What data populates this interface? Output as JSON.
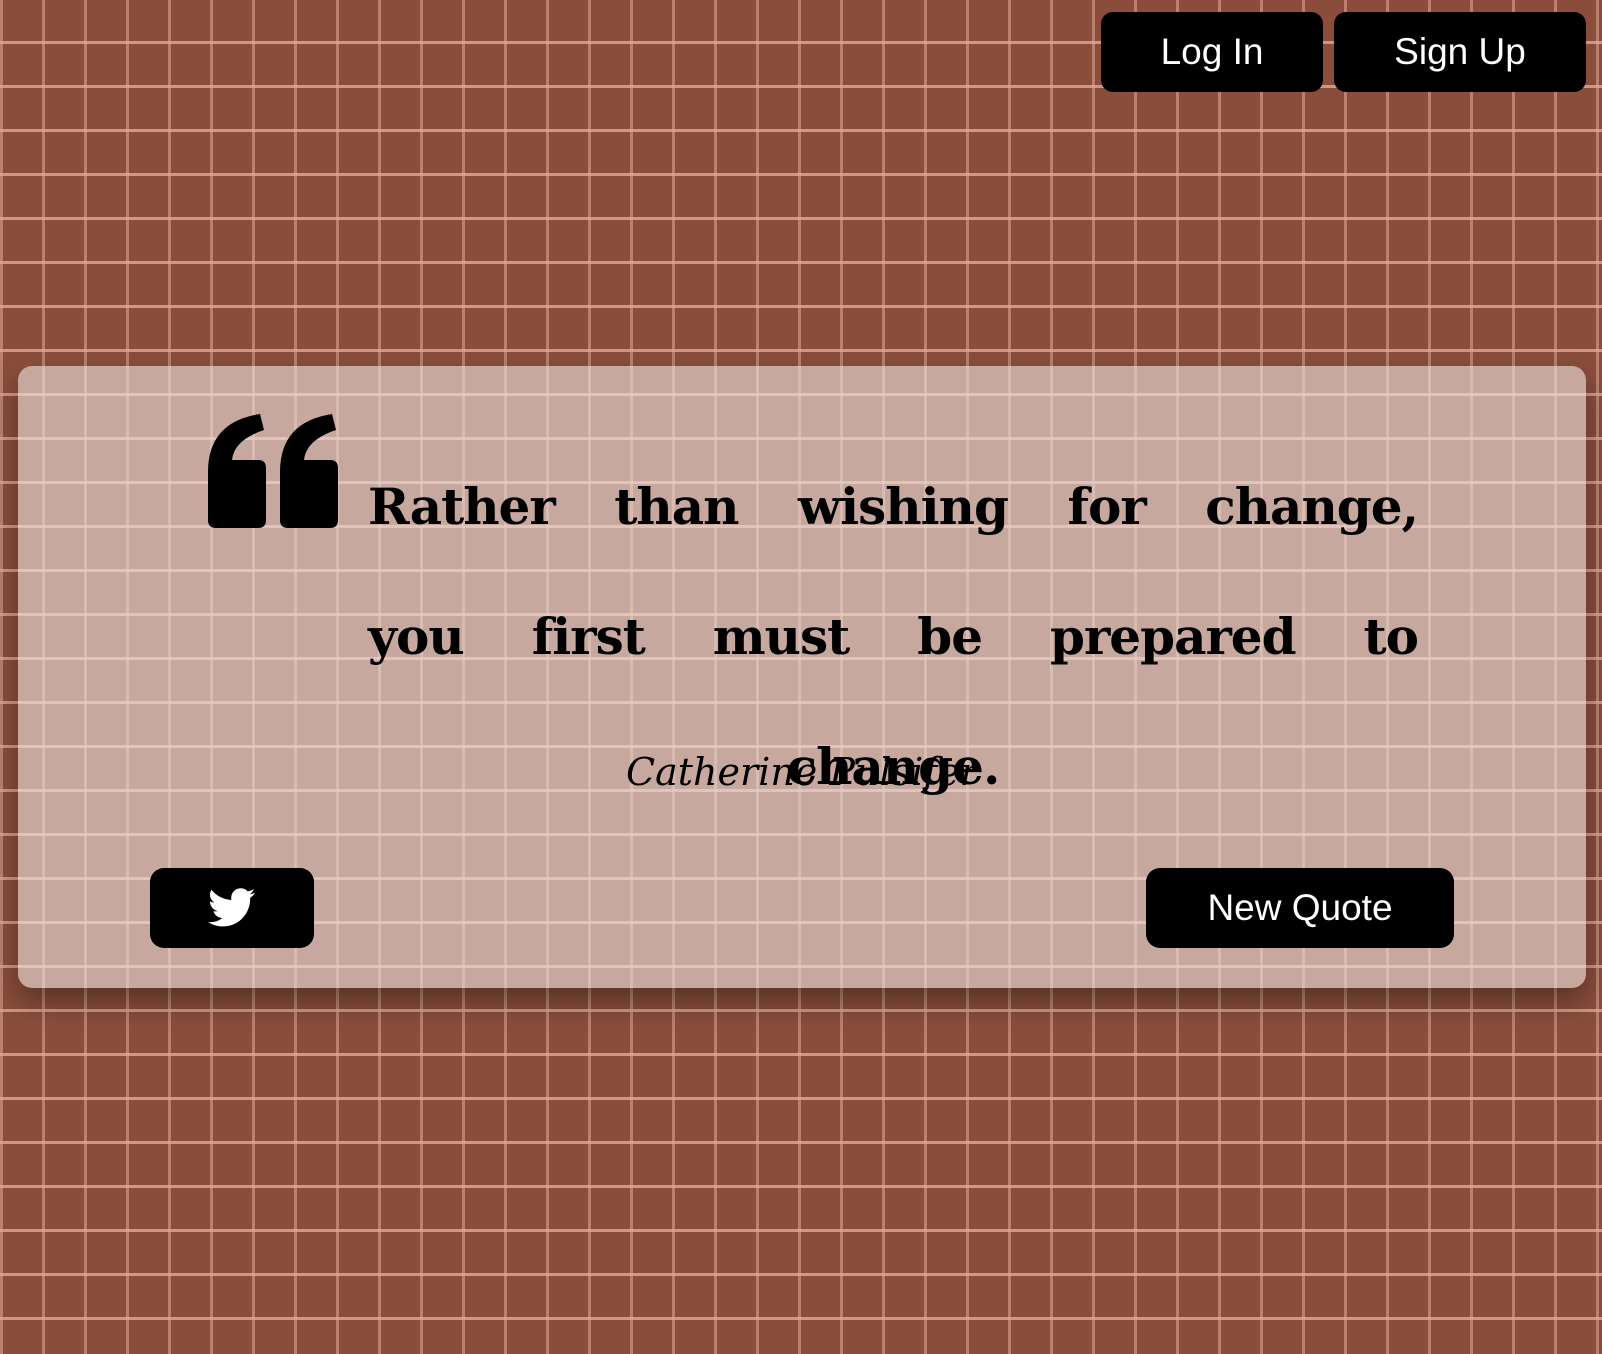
{
  "header": {
    "login_label": "Log In",
    "signup_label": "Sign Up"
  },
  "quote": {
    "text": "Rather than wishing for change, you first must be prepared to change.",
    "author": "Catherine Pulsifer",
    "quote_icon": "quote-left-icon"
  },
  "actions": {
    "tweet_icon": "twitter-icon",
    "new_quote_label": "New Quote"
  },
  "colors": {
    "brick": "#8a4d3b",
    "mortar": "#deaa96",
    "button_bg": "#000000",
    "button_text": "#ffffff"
  }
}
